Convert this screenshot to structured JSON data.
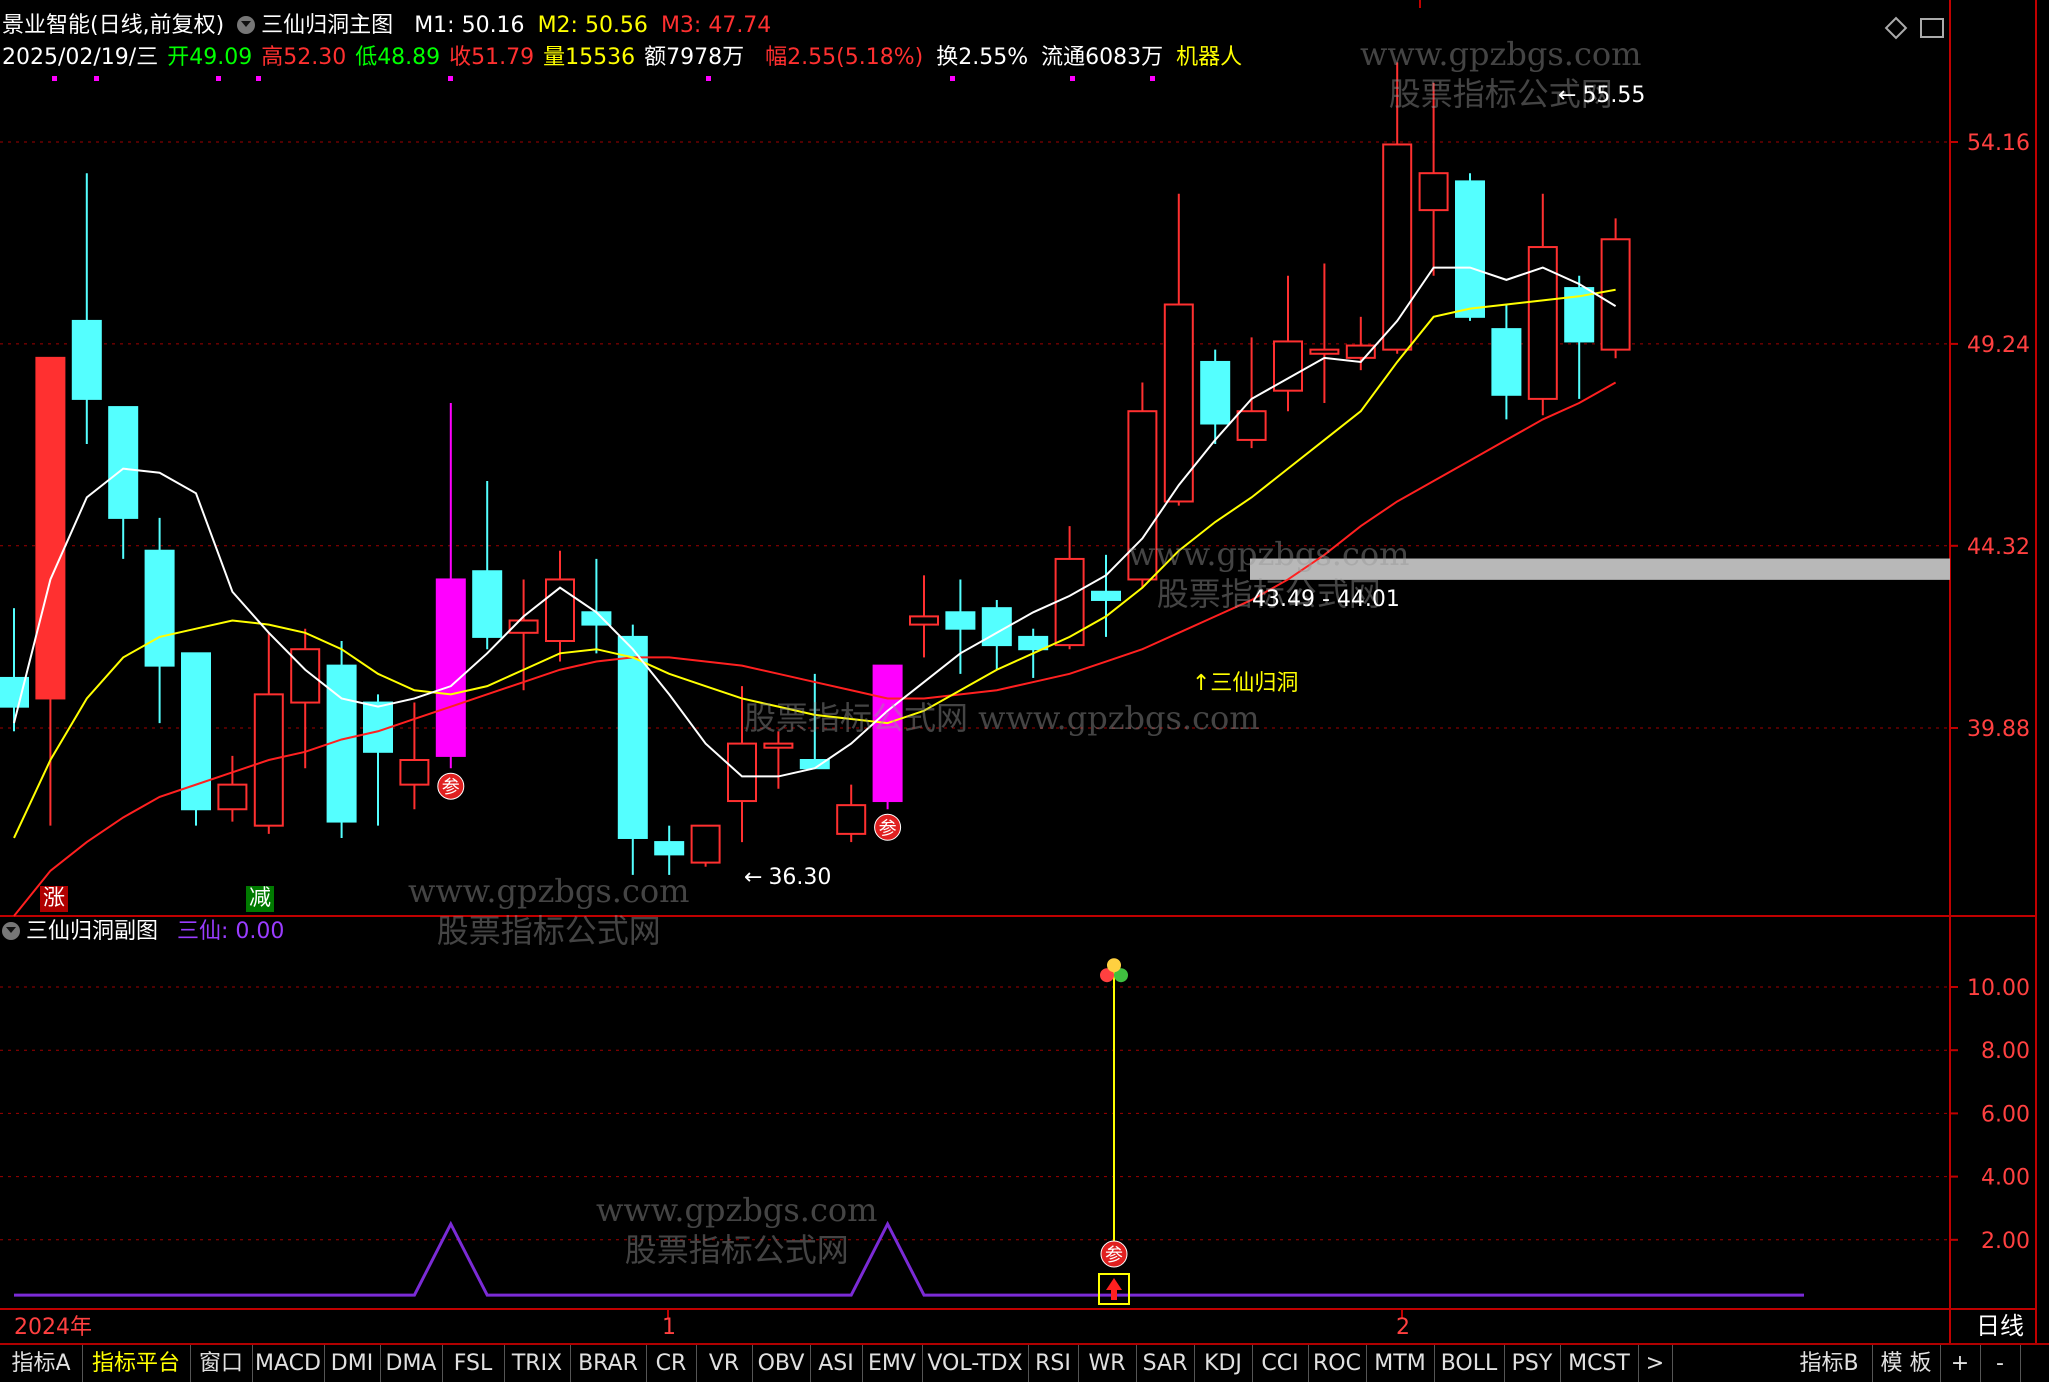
{
  "header": {
    "stock_title": "景业智能(日线,前复权)",
    "main_indicator": "三仙归洞主图",
    "ma": [
      {
        "label": "M1: 50.16",
        "color": "#ffffff"
      },
      {
        "label": "M2: 50.56",
        "color": "#ffff00"
      },
      {
        "label": "M3: 47.74",
        "color": "#ff3030"
      }
    ],
    "quote": {
      "date": "2025/02/19/三",
      "open": "开49.09",
      "high": "高52.30",
      "low": "低48.89",
      "close": "收51.79",
      "volume": "量15536",
      "amount": "额7978万",
      "change": "幅2.55(5.18%)",
      "turnover": "换2.55%",
      "float": "流通6083万",
      "robot": "机器人"
    }
  },
  "sub_header": {
    "indicator": "三仙归洞副图",
    "value_label": "三仙: 0.00"
  },
  "watermarks": [
    {
      "line1": "www.gpzbgs.com",
      "line2": "股票指标公式网"
    },
    {
      "line1": "www.gpzbgs.com",
      "line2": "股票指标公式网"
    },
    {
      "line1": "股票指标公式网 www.gpzbgs.com",
      "line2": ""
    },
    {
      "line1": "www.gpzbgs.com",
      "line2": "股票指标公式网"
    },
    {
      "line1": "www.gpzbgs.com",
      "line2": "股票指标公式网"
    }
  ],
  "annotations": {
    "high_marker": "55.55",
    "low_marker": "36.30",
    "gap_label": "43.49 - 44.01",
    "signal_label": "↑三仙归洞",
    "rise_tag": "涨",
    "fall_tag": "减",
    "can_marker": "参"
  },
  "axis": {
    "year_label": "2024年",
    "month_labels": [
      "1",
      "2"
    ],
    "period": "日线"
  },
  "bottom_tabs": [
    "指标A",
    "指标平台",
    "窗口",
    "MACD",
    "DMI",
    "DMA",
    "FSL",
    "TRIX",
    "BRAR",
    "CR",
    "VR",
    "OBV",
    "ASI",
    "EMV",
    "VOL-TDX",
    "RSI",
    "WR",
    "SAR",
    "KDJ",
    "CCI",
    "ROC",
    "MTM",
    "BOLL",
    "PSY",
    "MCST",
    ">",
    "指标B",
    "模 板",
    "+",
    "-"
  ],
  "colors": {
    "up": "#ff3030",
    "down": "#54ffff",
    "special": "#ff00ff",
    "ma1": "#ffffff",
    "ma2": "#ffff00",
    "ma3": "#ff2020",
    "grid": "#a00000",
    "sub_line": "#7b2bd6"
  },
  "chart_data": [
    {
      "type": "candlestick",
      "title": "三仙归洞主图",
      "y_ticks": [
        54.16,
        49.24,
        44.32,
        39.88
      ],
      "ylim": [
        34.5,
        57.5
      ],
      "candles": [
        {
          "o": 41.1,
          "c": 40.4,
          "h": 42.8,
          "l": 39.8
        },
        {
          "o": 40.6,
          "c": 48.9,
          "h": 48.9,
          "l": 37.5
        },
        {
          "o": 49.8,
          "c": 47.9,
          "h": 53.4,
          "l": 46.8
        },
        {
          "o": 47.7,
          "c": 45.0,
          "h": 47.7,
          "l": 44.0
        },
        {
          "o": 44.2,
          "c": 41.4,
          "h": 45.0,
          "l": 40.0
        },
        {
          "o": 41.7,
          "c": 37.9,
          "h": 41.7,
          "l": 37.5
        },
        {
          "o": 37.9,
          "c": 38.5,
          "h": 39.2,
          "l": 37.6
        },
        {
          "o": 37.5,
          "c": 40.7,
          "h": 42.2,
          "l": 37.3
        },
        {
          "o": 40.5,
          "c": 41.8,
          "h": 42.3,
          "l": 38.9
        },
        {
          "o": 41.4,
          "c": 37.6,
          "h": 42.0,
          "l": 37.2
        },
        {
          "o": 40.5,
          "c": 39.3,
          "h": 40.7,
          "l": 37.5
        },
        {
          "o": 38.5,
          "c": 39.1,
          "h": 40.5,
          "l": 37.9
        },
        {
          "o": 39.2,
          "c": 43.5,
          "h": 47.8,
          "l": 38.9
        },
        {
          "o": 43.7,
          "c": 42.1,
          "h": 45.9,
          "l": 41.8
        },
        {
          "o": 42.2,
          "c": 42.5,
          "h": 43.5,
          "l": 40.8
        },
        {
          "o": 42.0,
          "c": 43.5,
          "h": 44.2,
          "l": 41.5
        },
        {
          "o": 42.7,
          "c": 42.4,
          "h": 44.0,
          "l": 41.7
        },
        {
          "o": 42.1,
          "c": 37.2,
          "h": 42.4,
          "l": 36.3
        },
        {
          "o": 37.1,
          "c": 36.8,
          "h": 37.5,
          "l": 36.3
        },
        {
          "o": 36.6,
          "c": 37.5,
          "h": 37.5,
          "l": 36.5
        },
        {
          "o": 38.1,
          "c": 39.5,
          "h": 40.9,
          "l": 37.1
        },
        {
          "o": 39.4,
          "c": 39.5,
          "h": 39.8,
          "l": 38.4
        },
        {
          "o": 39.1,
          "c": 38.9,
          "h": 41.2,
          "l": 38.9
        },
        {
          "o": 37.3,
          "c": 38.0,
          "h": 38.5,
          "l": 37.1
        },
        {
          "o": 38.1,
          "c": 41.4,
          "h": 41.4,
          "l": 37.9
        },
        {
          "o": 42.4,
          "c": 42.6,
          "h": 43.6,
          "l": 41.6
        },
        {
          "o": 42.7,
          "c": 42.3,
          "h": 43.5,
          "l": 41.2
        },
        {
          "o": 42.8,
          "c": 41.9,
          "h": 43.0,
          "l": 41.3
        },
        {
          "o": 42.1,
          "c": 41.8,
          "h": 42.3,
          "l": 41.1
        },
        {
          "o": 41.9,
          "c": 44.0,
          "h": 44.8,
          "l": 41.8
        },
        {
          "o": 43.2,
          "c": 43.0,
          "h": 44.1,
          "l": 42.1
        },
        {
          "o": 43.5,
          "c": 47.6,
          "h": 48.3,
          "l": 43.3
        },
        {
          "o": 45.4,
          "c": 50.2,
          "h": 52.9,
          "l": 45.3
        },
        {
          "o": 48.8,
          "c": 47.3,
          "h": 49.1,
          "l": 46.8
        },
        {
          "o": 46.9,
          "c": 47.6,
          "h": 49.4,
          "l": 46.7
        },
        {
          "o": 48.1,
          "c": 49.3,
          "h": 50.9,
          "l": 47.6
        },
        {
          "o": 49.0,
          "c": 49.1,
          "h": 51.2,
          "l": 47.8
        },
        {
          "o": 48.9,
          "c": 49.2,
          "h": 49.9,
          "l": 48.6
        },
        {
          "o": 49.1,
          "c": 54.1,
          "h": 56.1,
          "l": 49.0
        },
        {
          "o": 52.5,
          "c": 53.4,
          "h": 55.6,
          "l": 50.9
        },
        {
          "o": 53.2,
          "c": 49.9,
          "h": 53.4,
          "l": 49.8
        },
        {
          "o": 49.6,
          "c": 48.0,
          "h": 50.2,
          "l": 47.4
        },
        {
          "o": 47.9,
          "c": 51.6,
          "h": 52.9,
          "l": 47.5
        },
        {
          "o": 50.6,
          "c": 49.3,
          "h": 50.9,
          "l": 47.9
        },
        {
          "o": 49.1,
          "c": 51.79,
          "h": 52.3,
          "l": 48.89
        }
      ],
      "special_magenta": [
        12,
        24
      ],
      "ma1": [
        40.0,
        43.5,
        45.5,
        46.2,
        46.1,
        45.6,
        43.2,
        42.2,
        41.3,
        40.6,
        40.4,
        40.6,
        40.9,
        41.7,
        42.6,
        43.3,
        42.7,
        41.8,
        40.7,
        39.5,
        38.7,
        38.7,
        38.9,
        39.5,
        40.3,
        41.0,
        41.7,
        42.2,
        42.7,
        43.1,
        43.6,
        44.5,
        45.8,
        46.9,
        47.9,
        48.4,
        48.9,
        48.8,
        49.8,
        51.1,
        51.1,
        50.8,
        51.1,
        50.7,
        50.16
      ],
      "ma2": [
        37.2,
        39.1,
        40.6,
        41.6,
        42.1,
        42.3,
        42.5,
        42.4,
        42.2,
        41.8,
        41.2,
        40.8,
        40.7,
        40.9,
        41.3,
        41.7,
        41.8,
        41.6,
        41.2,
        40.9,
        40.6,
        40.4,
        40.2,
        40.1,
        40.0,
        40.3,
        40.8,
        41.3,
        41.7,
        42.1,
        42.6,
        43.3,
        44.2,
        44.9,
        45.5,
        46.2,
        46.9,
        47.6,
        48.8,
        49.9,
        50.1,
        50.2,
        50.3,
        50.4,
        50.56
      ],
      "ma3": [
        35.3,
        36.4,
        37.1,
        37.7,
        38.2,
        38.5,
        38.8,
        39.1,
        39.3,
        39.6,
        39.8,
        40.1,
        40.4,
        40.7,
        41.0,
        41.3,
        41.5,
        41.6,
        41.6,
        41.5,
        41.4,
        41.2,
        41.0,
        40.8,
        40.6,
        40.6,
        40.7,
        40.8,
        41.0,
        41.2,
        41.5,
        41.8,
        42.2,
        42.6,
        43.0,
        43.5,
        44.1,
        44.8,
        45.4,
        45.9,
        46.4,
        46.9,
        47.4,
        47.8,
        48.3
      ],
      "gap_band": [
        43.49,
        44.01
      ]
    },
    {
      "type": "line",
      "title": "三仙归洞副图",
      "y_ticks": [
        10.0,
        8.0,
        6.0,
        4.0,
        2.0
      ],
      "ylim": [
        0,
        12
      ],
      "spikes": [
        {
          "index": 12,
          "value": 1.0
        },
        {
          "index": 24,
          "value": 1.0
        }
      ],
      "signal": {
        "index": 30,
        "value": 10.5
      }
    }
  ]
}
